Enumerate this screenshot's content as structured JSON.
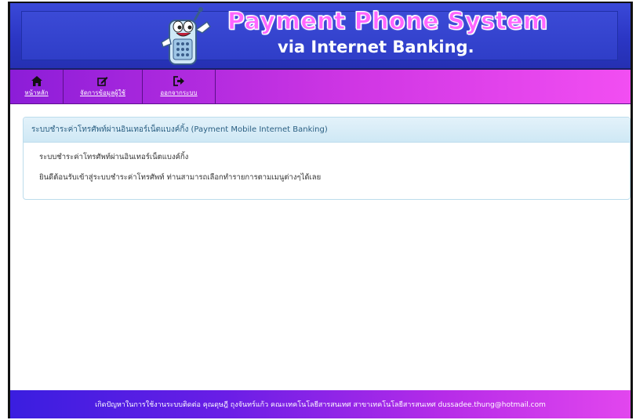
{
  "banner": {
    "title_main": "Payment Phone System",
    "title_sub": "via Internet Banking.",
    "colors": {
      "banner_blue": "#2f3ec8",
      "title_pink": "#ff66ff"
    }
  },
  "nav": {
    "items": [
      {
        "label": "หน้าหลัก",
        "icon": "home-icon"
      },
      {
        "label": "จัดการข้อมูลผู้ใช้",
        "icon": "edit-icon"
      },
      {
        "label": "ออกจากระบบ",
        "icon": "sign-out-icon"
      }
    ],
    "colors": {
      "start": "#8c1dd8",
      "end": "#f24ef2"
    }
  },
  "panel": {
    "heading": "ระบบชำระค่าโทรศัพท์ผ่านอินเทอร์เน็ตแบงค์กิ้ง (Payment Mobile Internet Banking)",
    "line1": "ระบบชำระค่าโทรศัพท์ผ่านอินเทอร์เน็ตแบงค์กิ้ง",
    "line2": "ยินดีต้อนรับเข้าสู่ระบบชำระค่าโทรศัพท์ ท่านสามารถเลือกทำรายการตามเมนูต่างๆได้เลย"
  },
  "footer": {
    "text": "เกิดปัญหาในการใช้งานระบบติดต่อ คุณดุษฎี ถุงจันทร์แก้ว คณะเทคโนโลยีสารสนเทศ สาขาเทคโนโลยีสารสนเทศ dussadee.thung@hotmail.com"
  }
}
